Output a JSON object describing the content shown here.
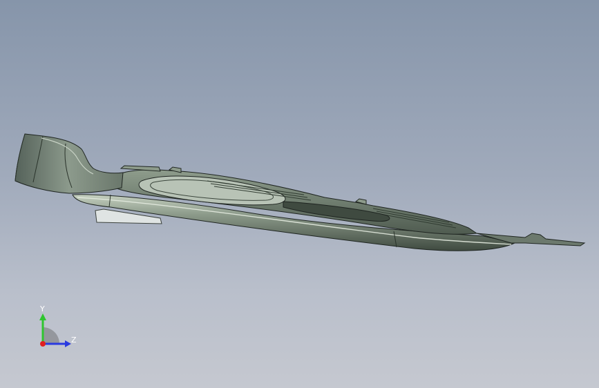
{
  "viewport": {
    "background_top": "#8695aa",
    "background_bottom": "#c5c8d0"
  },
  "model": {
    "icon": "cad-part-icon",
    "body_color": "#6f7d6f",
    "edge_color": "#1e2420"
  },
  "triad": {
    "x_label": "",
    "y_label": "Y",
    "z_label": "Z",
    "y_color": "#2fc52f",
    "z_color": "#2a3ae0",
    "x_color": "#e02020"
  }
}
